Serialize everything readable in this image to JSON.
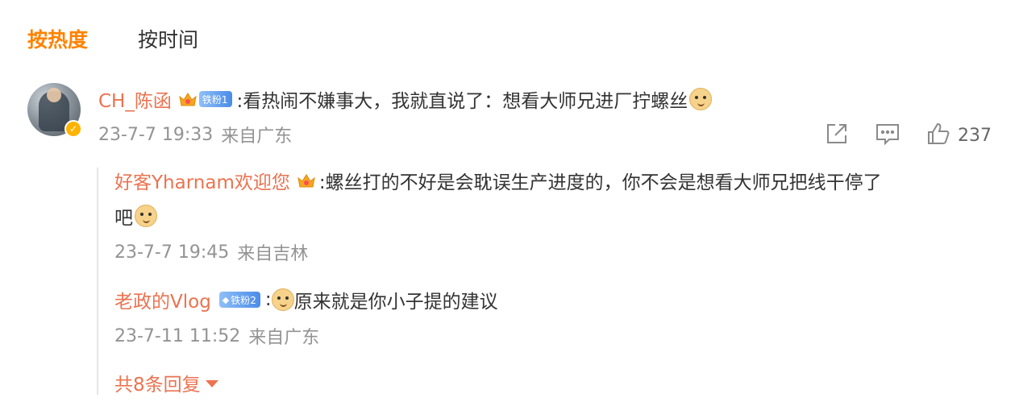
{
  "tabs": {
    "hot": "按热度",
    "time": "按时间"
  },
  "comment": {
    "user": "CH_陈函",
    "fan_badge": "铁粉1",
    "text": ":看热闹不嫌事大，我就直说了：想看大师兄进厂拧螺丝",
    "time": "23-7-7 19:33",
    "location": "来自广东",
    "likes": "237",
    "verified_icon": "v-badge"
  },
  "replies": [
    {
      "user": "好客Yharnam欢迎您",
      "text_line1": ":螺丝打的不好是会耽误生产进度的，你不会是想看大师兄把线干停了",
      "text_line2": "吧",
      "time": "23-7-7 19:45",
      "location": "来自吉林"
    },
    {
      "user": "老政的Vlog",
      "fan_badge": "铁粉2",
      "text": "原来就是你小子提的建议",
      "time": "23-7-11 11:52",
      "location": "来自广东"
    }
  ],
  "more_replies": "共8条回复",
  "colors": {
    "accent": "#ff8200",
    "username": "#eb7350",
    "meta": "#939393"
  }
}
